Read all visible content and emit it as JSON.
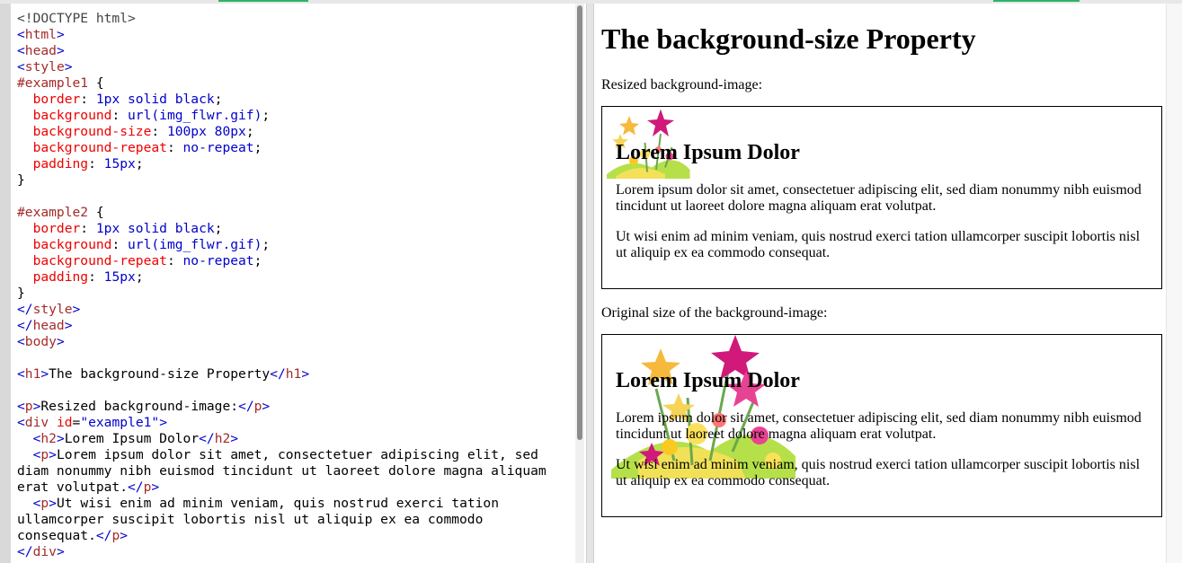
{
  "code_lines": [
    [
      [
        "t-punc",
        "<!DOCTYPE html>"
      ]
    ],
    [
      [
        "t-bracket",
        "<"
      ],
      [
        "t-tag",
        "html"
      ],
      [
        "t-bracket",
        ">"
      ]
    ],
    [
      [
        "t-bracket",
        "<"
      ],
      [
        "t-tag",
        "head"
      ],
      [
        "t-bracket",
        ">"
      ]
    ],
    [
      [
        "t-bracket",
        "<"
      ],
      [
        "t-tag",
        "style"
      ],
      [
        "t-bracket",
        ">"
      ]
    ],
    [
      [
        "t-sel",
        "#example1"
      ],
      [
        "t-txt",
        " {"
      ]
    ],
    [
      [
        "t-prop",
        "  border"
      ],
      [
        "t-txt",
        ": "
      ],
      [
        "t-val",
        "1px solid black"
      ],
      [
        "t-txt",
        ";"
      ]
    ],
    [
      [
        "t-prop",
        "  background"
      ],
      [
        "t-txt",
        ": "
      ],
      [
        "t-val",
        "url(img_flwr.gif)"
      ],
      [
        "t-txt",
        ";"
      ]
    ],
    [
      [
        "t-prop",
        "  background-size"
      ],
      [
        "t-txt",
        ": "
      ],
      [
        "t-val",
        "100px 80px"
      ],
      [
        "t-txt",
        ";"
      ]
    ],
    [
      [
        "t-prop",
        "  background-repeat"
      ],
      [
        "t-txt",
        ": "
      ],
      [
        "t-val",
        "no-repeat"
      ],
      [
        "t-txt",
        ";"
      ]
    ],
    [
      [
        "t-prop",
        "  padding"
      ],
      [
        "t-txt",
        ": "
      ],
      [
        "t-val",
        "15px"
      ],
      [
        "t-txt",
        ";"
      ]
    ],
    [
      [
        "t-txt",
        "}"
      ]
    ],
    [
      [
        "t-txt",
        ""
      ]
    ],
    [
      [
        "t-sel",
        "#example2"
      ],
      [
        "t-txt",
        " {"
      ]
    ],
    [
      [
        "t-prop",
        "  border"
      ],
      [
        "t-txt",
        ": "
      ],
      [
        "t-val",
        "1px solid black"
      ],
      [
        "t-txt",
        ";"
      ]
    ],
    [
      [
        "t-prop",
        "  background"
      ],
      [
        "t-txt",
        ": "
      ],
      [
        "t-val",
        "url(img_flwr.gif)"
      ],
      [
        "t-txt",
        ";"
      ]
    ],
    [
      [
        "t-prop",
        "  background-repeat"
      ],
      [
        "t-txt",
        ": "
      ],
      [
        "t-val",
        "no-repeat"
      ],
      [
        "t-txt",
        ";"
      ]
    ],
    [
      [
        "t-prop",
        "  padding"
      ],
      [
        "t-txt",
        ": "
      ],
      [
        "t-val",
        "15px"
      ],
      [
        "t-txt",
        ";"
      ]
    ],
    [
      [
        "t-txt",
        "}"
      ]
    ],
    [
      [
        "t-bracket",
        "</"
      ],
      [
        "t-tag",
        "style"
      ],
      [
        "t-bracket",
        ">"
      ]
    ],
    [
      [
        "t-bracket",
        "</"
      ],
      [
        "t-tag",
        "head"
      ],
      [
        "t-bracket",
        ">"
      ]
    ],
    [
      [
        "t-bracket",
        "<"
      ],
      [
        "t-tag",
        "body"
      ],
      [
        "t-bracket",
        ">"
      ]
    ],
    [
      [
        "t-txt",
        ""
      ]
    ],
    [
      [
        "t-bracket",
        "<"
      ],
      [
        "t-tag",
        "h1"
      ],
      [
        "t-bracket",
        ">"
      ],
      [
        "t-txt",
        "The background-size Property"
      ],
      [
        "t-bracket",
        "</"
      ],
      [
        "t-tag",
        "h1"
      ],
      [
        "t-bracket",
        ">"
      ]
    ],
    [
      [
        "t-txt",
        ""
      ]
    ],
    [
      [
        "t-bracket",
        "<"
      ],
      [
        "t-tag",
        "p"
      ],
      [
        "t-bracket",
        ">"
      ],
      [
        "t-txt",
        "Resized background-image:"
      ],
      [
        "t-bracket",
        "</"
      ],
      [
        "t-tag",
        "p"
      ],
      [
        "t-bracket",
        ">"
      ]
    ],
    [
      [
        "t-bracket",
        "<"
      ],
      [
        "t-tag",
        "div"
      ],
      [
        "t-attr",
        " id"
      ],
      [
        "t-txt",
        "="
      ],
      [
        "t-str",
        "\"example1\""
      ],
      [
        "t-bracket",
        ">"
      ]
    ],
    [
      [
        "t-txt",
        "  "
      ],
      [
        "t-bracket",
        "<"
      ],
      [
        "t-tag",
        "h2"
      ],
      [
        "t-bracket",
        ">"
      ],
      [
        "t-txt",
        "Lorem Ipsum Dolor"
      ],
      [
        "t-bracket",
        "</"
      ],
      [
        "t-tag",
        "h2"
      ],
      [
        "t-bracket",
        ">"
      ]
    ],
    [
      [
        "t-txt",
        "  "
      ],
      [
        "t-bracket",
        "<"
      ],
      [
        "t-tag",
        "p"
      ],
      [
        "t-bracket",
        ">"
      ],
      [
        "t-txt",
        "Lorem ipsum dolor sit amet, consectetuer adipiscing elit, sed"
      ]
    ],
    [
      [
        "t-txt",
        "diam nonummy nibh euismod tincidunt ut laoreet dolore magna aliquam"
      ]
    ],
    [
      [
        "t-txt",
        "erat volutpat."
      ],
      [
        "t-bracket",
        "</"
      ],
      [
        "t-tag",
        "p"
      ],
      [
        "t-bracket",
        ">"
      ]
    ],
    [
      [
        "t-txt",
        "  "
      ],
      [
        "t-bracket",
        "<"
      ],
      [
        "t-tag",
        "p"
      ],
      [
        "t-bracket",
        ">"
      ],
      [
        "t-txt",
        "Ut wisi enim ad minim veniam, quis nostrud exerci tation"
      ]
    ],
    [
      [
        "t-txt",
        "ullamcorper suscipit lobortis nisl ut aliquip ex ea commodo"
      ]
    ],
    [
      [
        "t-txt",
        "consequat."
      ],
      [
        "t-bracket",
        "</"
      ],
      [
        "t-tag",
        "p"
      ],
      [
        "t-bracket",
        ">"
      ]
    ],
    [
      [
        "t-bracket",
        "</"
      ],
      [
        "t-tag",
        "div"
      ],
      [
        "t-bracket",
        ">"
      ]
    ]
  ],
  "result": {
    "title": "The background-size Property",
    "caption1": "Resized background-image:",
    "caption2": "Original size of the background-image:",
    "box1": {
      "heading": "Lorem Ipsum Dolor",
      "p1": "Lorem ipsum dolor sit amet, consectetuer adipiscing elit, sed diam nonummy nibh euismod tincidunt ut laoreet dolore magna aliquam erat volutpat.",
      "p2": "Ut wisi enim ad minim veniam, quis nostrud exerci tation ullamcorper suscipit lobortis nisl ut aliquip ex ea commodo consequat."
    },
    "box2": {
      "heading": "Lorem Ipsum Dolor",
      "p1": "Lorem ipsum dolor sit amet, consectetuer adipiscing elit, sed diam nonummy nibh euismod tincidunt ut laoreet dolore magna aliquam erat volutpat.",
      "p2": "Ut wisi enim ad minim veniam, quis nostrud exerci tation ullamcorper suscipit lobortis nisl ut aliquip ex ea commodo consequat."
    }
  },
  "icons": {
    "background_image": "flower-bouquet-icon"
  },
  "colors": {
    "tag": "#a52a2a",
    "property": "#ee0000",
    "value": "#0000cd",
    "accent": "#2fb36a"
  }
}
